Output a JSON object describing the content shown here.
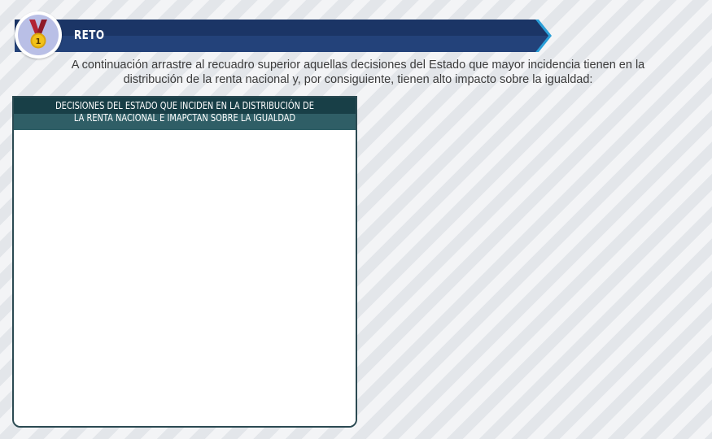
{
  "header": {
    "title": "RETO",
    "badge_icon": "medal-icon",
    "badge_number": "1"
  },
  "instructions": {
    "text": "A continuación arrastre al recuadro superior aquellas decisiones del Estado que mayor incidencia tienen en la distribución de la renta nacional y, por consiguiente, tienen alto impacto sobre la igualdad:"
  },
  "panel": {
    "header_line1": "DECISIONES DEL ESTADO QUE INCIDEN EN LA DISTRIBUCIÓN DE",
    "header_line2": "LA RENTA NACIONAL E IMAPCTAN SOBRE LA IGUALDAD"
  },
  "colors": {
    "banner_dark": "#16325c",
    "banner_light": "#2a4a7a",
    "banner_arrow": "#2a9fd8",
    "panel_header_dark": "#183f47",
    "panel_header_light": "#2f5e66",
    "medal_ribbon": "#b22234",
    "medal_gold": "#f2c21a",
    "badge_bg": "#b9bfe6"
  }
}
